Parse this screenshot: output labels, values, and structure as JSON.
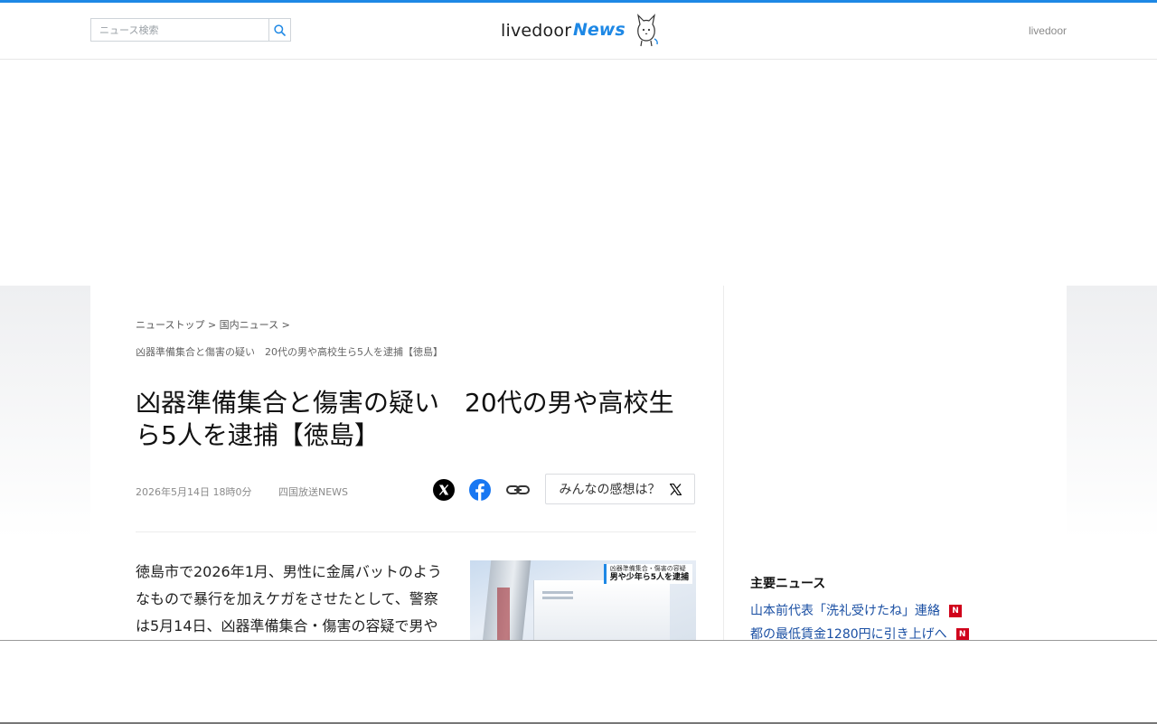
{
  "search": {
    "placeholder": "ニュース検索",
    "icon": "search-icon"
  },
  "logo": {
    "text": "livedoor",
    "accent": "News"
  },
  "header": {
    "right_link": "livedoor"
  },
  "breadcrumb": {
    "items": [
      "ニューストップ",
      "国内ニュース"
    ],
    "separator": ">",
    "current": "凶器準備集合と傷害の疑い　20代の男や高校生ら5人を逮捕【徳島】"
  },
  "article": {
    "title": "凶器準備集合と傷害の疑い　20代の男や高校生ら5人を逮捕【徳島】",
    "date": "2026年5月14日 18時0分",
    "source": "四国放送NEWS",
    "body": "徳島市で2026年1月、男性に金属バットのようなもので暴行を加えケガをさせたとして、警察は5月14日、凶器準備集合・傷害の容疑で男や",
    "image_caption_top": "凶器準備集合・傷害の容疑",
    "image_caption_main": "男や少年ら5人を逮捕"
  },
  "share": {
    "icons": [
      "x-icon",
      "facebook-icon",
      "link-icon"
    ],
    "kanso_label": "みんなの感想は？"
  },
  "sidebar": {
    "heading": "主要ニュース",
    "items": [
      {
        "label": "山本前代表「洗礼受けたね」連絡",
        "badge": "N"
      },
      {
        "label": "都の最低賃金1280円に引き上げへ",
        "badge": "N"
      }
    ]
  },
  "colors": {
    "accent": "#1e88e5",
    "link": "#1a4fa3",
    "badge": "#d0021b"
  }
}
